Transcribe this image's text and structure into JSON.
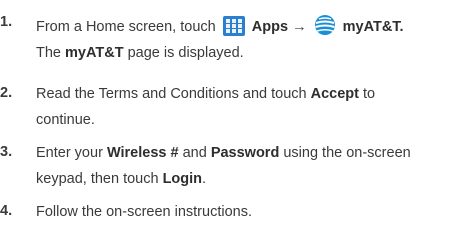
{
  "steps": [
    {
      "number": "1.",
      "parts": {
        "t1": "From a Home screen, touch",
        "apps": "Apps",
        "arrow": "→",
        "myatt": "myAT&T."
      },
      "note": {
        "t1": "The",
        "b1": "myAT&T",
        "t2": "page is displayed."
      }
    },
    {
      "number": "2.",
      "line1": {
        "t1": "Read the Terms and Conditions and touch",
        "b1": "Accept",
        "t2": "to"
      },
      "line2": "continue."
    },
    {
      "number": "3.",
      "line1": {
        "t1": "Enter your",
        "b1": "Wireless #",
        "t2": "and",
        "b2": "Password",
        "t3": "using the on-screen"
      },
      "line2": {
        "t1": "keypad, then touch",
        "b1": "Login",
        "t2": "."
      }
    },
    {
      "number": "4.",
      "line1": "Follow the on-screen instructions."
    }
  ],
  "icons": {
    "apps": "apps-grid-icon",
    "myatt": "att-globe-icon"
  },
  "colors": {
    "text": "#3a3a3a",
    "apps_icon_bg": "#2b7fd0",
    "att_blue": "#1a8fd6"
  }
}
